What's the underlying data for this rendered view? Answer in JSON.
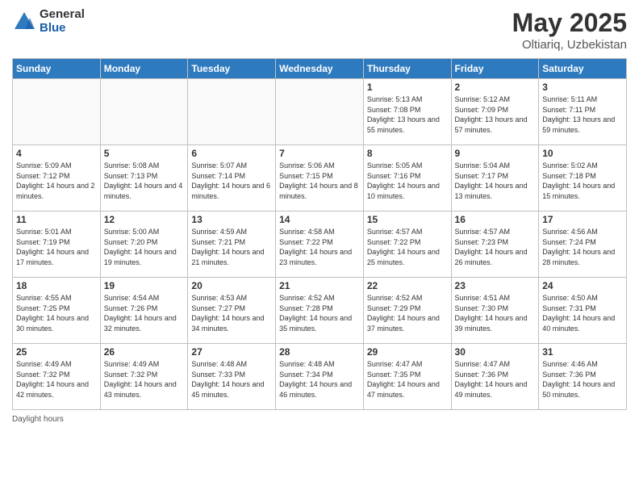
{
  "header": {
    "logo_general": "General",
    "logo_blue": "Blue",
    "title": "May 2025",
    "location": "Oltiariq, Uzbekistan"
  },
  "days_of_week": [
    "Sunday",
    "Monday",
    "Tuesday",
    "Wednesday",
    "Thursday",
    "Friday",
    "Saturday"
  ],
  "weeks": [
    [
      {
        "day": "",
        "info": ""
      },
      {
        "day": "",
        "info": ""
      },
      {
        "day": "",
        "info": ""
      },
      {
        "day": "",
        "info": ""
      },
      {
        "day": "1",
        "info": "Sunrise: 5:13 AM\nSunset: 7:08 PM\nDaylight: 13 hours\nand 55 minutes."
      },
      {
        "day": "2",
        "info": "Sunrise: 5:12 AM\nSunset: 7:09 PM\nDaylight: 13 hours\nand 57 minutes."
      },
      {
        "day": "3",
        "info": "Sunrise: 5:11 AM\nSunset: 7:11 PM\nDaylight: 13 hours\nand 59 minutes."
      }
    ],
    [
      {
        "day": "4",
        "info": "Sunrise: 5:09 AM\nSunset: 7:12 PM\nDaylight: 14 hours\nand 2 minutes."
      },
      {
        "day": "5",
        "info": "Sunrise: 5:08 AM\nSunset: 7:13 PM\nDaylight: 14 hours\nand 4 minutes."
      },
      {
        "day": "6",
        "info": "Sunrise: 5:07 AM\nSunset: 7:14 PM\nDaylight: 14 hours\nand 6 minutes."
      },
      {
        "day": "7",
        "info": "Sunrise: 5:06 AM\nSunset: 7:15 PM\nDaylight: 14 hours\nand 8 minutes."
      },
      {
        "day": "8",
        "info": "Sunrise: 5:05 AM\nSunset: 7:16 PM\nDaylight: 14 hours\nand 10 minutes."
      },
      {
        "day": "9",
        "info": "Sunrise: 5:04 AM\nSunset: 7:17 PM\nDaylight: 14 hours\nand 13 minutes."
      },
      {
        "day": "10",
        "info": "Sunrise: 5:02 AM\nSunset: 7:18 PM\nDaylight: 14 hours\nand 15 minutes."
      }
    ],
    [
      {
        "day": "11",
        "info": "Sunrise: 5:01 AM\nSunset: 7:19 PM\nDaylight: 14 hours\nand 17 minutes."
      },
      {
        "day": "12",
        "info": "Sunrise: 5:00 AM\nSunset: 7:20 PM\nDaylight: 14 hours\nand 19 minutes."
      },
      {
        "day": "13",
        "info": "Sunrise: 4:59 AM\nSunset: 7:21 PM\nDaylight: 14 hours\nand 21 minutes."
      },
      {
        "day": "14",
        "info": "Sunrise: 4:58 AM\nSunset: 7:22 PM\nDaylight: 14 hours\nand 23 minutes."
      },
      {
        "day": "15",
        "info": "Sunrise: 4:57 AM\nSunset: 7:22 PM\nDaylight: 14 hours\nand 25 minutes."
      },
      {
        "day": "16",
        "info": "Sunrise: 4:57 AM\nSunset: 7:23 PM\nDaylight: 14 hours\nand 26 minutes."
      },
      {
        "day": "17",
        "info": "Sunrise: 4:56 AM\nSunset: 7:24 PM\nDaylight: 14 hours\nand 28 minutes."
      }
    ],
    [
      {
        "day": "18",
        "info": "Sunrise: 4:55 AM\nSunset: 7:25 PM\nDaylight: 14 hours\nand 30 minutes."
      },
      {
        "day": "19",
        "info": "Sunrise: 4:54 AM\nSunset: 7:26 PM\nDaylight: 14 hours\nand 32 minutes."
      },
      {
        "day": "20",
        "info": "Sunrise: 4:53 AM\nSunset: 7:27 PM\nDaylight: 14 hours\nand 34 minutes."
      },
      {
        "day": "21",
        "info": "Sunrise: 4:52 AM\nSunset: 7:28 PM\nDaylight: 14 hours\nand 35 minutes."
      },
      {
        "day": "22",
        "info": "Sunrise: 4:52 AM\nSunset: 7:29 PM\nDaylight: 14 hours\nand 37 minutes."
      },
      {
        "day": "23",
        "info": "Sunrise: 4:51 AM\nSunset: 7:30 PM\nDaylight: 14 hours\nand 39 minutes."
      },
      {
        "day": "24",
        "info": "Sunrise: 4:50 AM\nSunset: 7:31 PM\nDaylight: 14 hours\nand 40 minutes."
      }
    ],
    [
      {
        "day": "25",
        "info": "Sunrise: 4:49 AM\nSunset: 7:32 PM\nDaylight: 14 hours\nand 42 minutes."
      },
      {
        "day": "26",
        "info": "Sunrise: 4:49 AM\nSunset: 7:32 PM\nDaylight: 14 hours\nand 43 minutes."
      },
      {
        "day": "27",
        "info": "Sunrise: 4:48 AM\nSunset: 7:33 PM\nDaylight: 14 hours\nand 45 minutes."
      },
      {
        "day": "28",
        "info": "Sunrise: 4:48 AM\nSunset: 7:34 PM\nDaylight: 14 hours\nand 46 minutes."
      },
      {
        "day": "29",
        "info": "Sunrise: 4:47 AM\nSunset: 7:35 PM\nDaylight: 14 hours\nand 47 minutes."
      },
      {
        "day": "30",
        "info": "Sunrise: 4:47 AM\nSunset: 7:36 PM\nDaylight: 14 hours\nand 49 minutes."
      },
      {
        "day": "31",
        "info": "Sunrise: 4:46 AM\nSunset: 7:36 PM\nDaylight: 14 hours\nand 50 minutes."
      }
    ]
  ],
  "footer": {
    "text": "Daylight hours"
  }
}
